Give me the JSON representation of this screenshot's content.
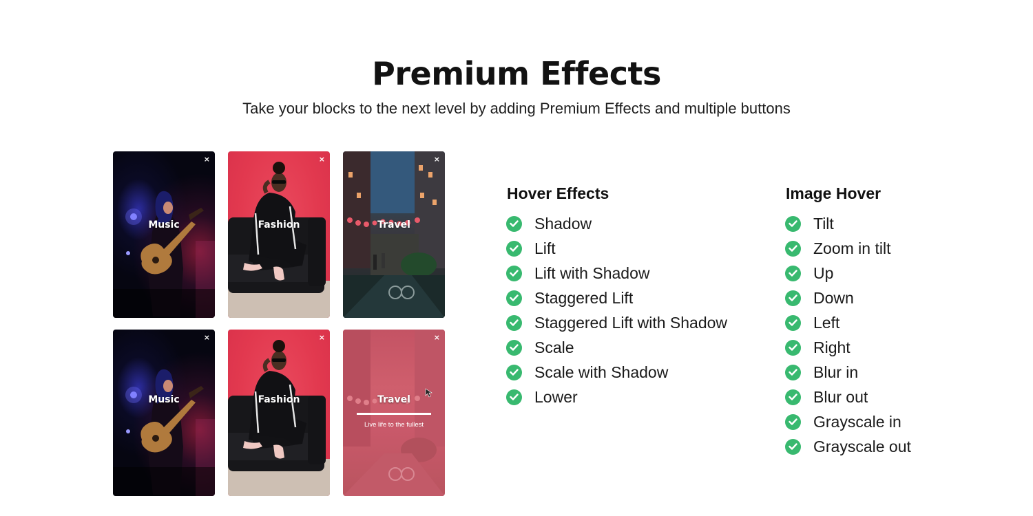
{
  "header": {
    "title": "Premium Effects",
    "subtitle": "Take your blocks to the next level by adding Premium Effects and multiple buttons"
  },
  "cards": {
    "close_glyph": "×",
    "music_label": "Music",
    "fashion_label": "Fashion",
    "travel_label": "Travel",
    "travel_tagline": "Live life to the fullest"
  },
  "hover_effects": {
    "title": "Hover Effects",
    "items": [
      "Shadow",
      "Lift",
      "Lift with Shadow",
      "Staggered Lift",
      "Staggered Lift with Shadow",
      "Scale",
      "Scale with Shadow",
      "Lower"
    ]
  },
  "image_hover": {
    "title": "Image Hover",
    "items": [
      "Tilt",
      "Zoom in tilt",
      "Up",
      "Down",
      "Left",
      "Right",
      "Blur in",
      "Blur out",
      "Grayscale in",
      "Grayscale out"
    ]
  },
  "colors": {
    "check": "#38b96f",
    "fashion_bg": "#e2394f",
    "music_bg": "#060611",
    "travel_overlay": "#c9596a"
  },
  "icons": {
    "check": "check-circle-icon",
    "close": "close-icon"
  }
}
